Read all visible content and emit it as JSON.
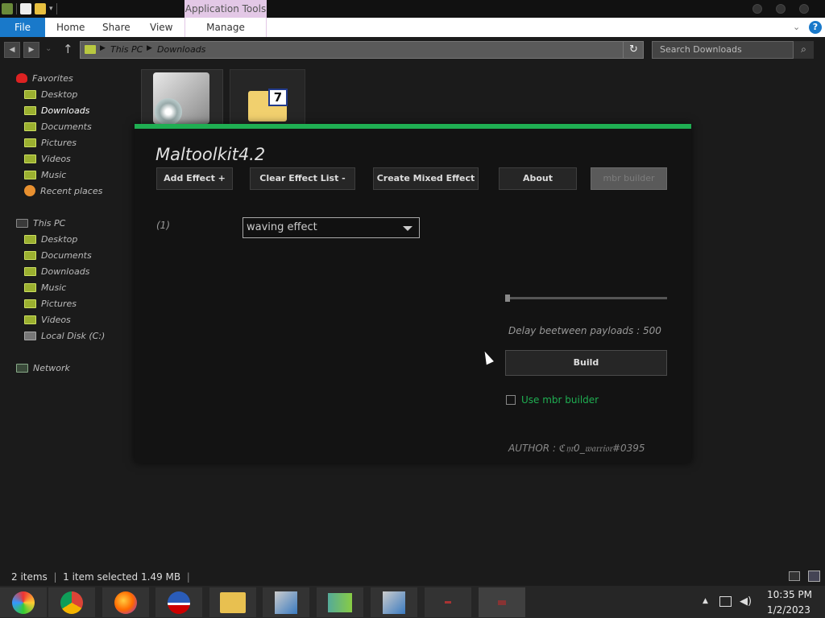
{
  "ribbon": {
    "context_tab_group": "Application Tools",
    "tabs": [
      "File",
      "Home",
      "Share",
      "View"
    ],
    "context_tab": "Manage"
  },
  "address": {
    "crumbs": [
      "This PC",
      "Downloads"
    ],
    "search_placeholder": "Search Downloads"
  },
  "sidebar": {
    "favorites_header": "Favorites",
    "favorites": [
      "Desktop",
      "Downloads",
      "Documents",
      "Pictures",
      "Videos",
      "Music",
      "Recent places"
    ],
    "thispc_header": "This PC",
    "thispc": [
      "Desktop",
      "Documents",
      "Downloads",
      "Music",
      "Pictures",
      "Videos",
      "Local Disk (C:)"
    ],
    "network": "Network"
  },
  "app": {
    "title": "Maltoolkit4.2",
    "buttons": {
      "add_effect": "Add Effect +",
      "clear_effects": "Clear Effect List -",
      "create_mixed": "Create Mixed Effect",
      "about": "About",
      "mbr_builder": "mbr builder"
    },
    "effect_index": "(1)",
    "effect_selected": "waving effect",
    "delay_label": "Delay beetween payloads : 500",
    "delay_value": 500,
    "build": "Build",
    "use_mbr_label": "Use mbr builder",
    "use_mbr_checked": false,
    "author": "AUTHOR : ℭ𝔶𝔯0_𝔴𝔞𝔯𝔯𝔦𝔬𝔯#0395",
    "accent_color": "#1fae52"
  },
  "status": {
    "items": "2 items",
    "selected": "1 item selected  1.49 MB"
  },
  "taskbar": {
    "apps": [
      "start-orb",
      "chrome",
      "firefox",
      "obama-logo-app",
      "file-explorer",
      "setup-installer",
      "network-users",
      "setup-installer-2",
      "app-dark",
      "app-dark-active"
    ]
  },
  "clock": {
    "time": "10:35 PM",
    "date": "1/2/2023"
  }
}
